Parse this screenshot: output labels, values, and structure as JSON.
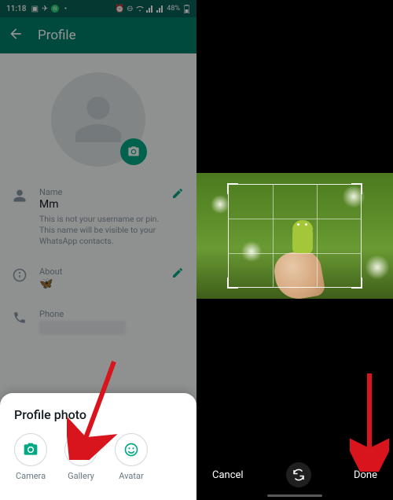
{
  "status": {
    "time": "11:18",
    "battery": "48%"
  },
  "left": {
    "appbar_title": "Profile",
    "fields": {
      "name_label": "Name",
      "name_value": "Mm",
      "name_hint": "This is not your username or pin. This name will be visible to your WhatsApp contacts.",
      "about_label": "About",
      "about_value": "🦋",
      "phone_label": "Phone"
    },
    "sheet": {
      "title": "Profile photo",
      "options": [
        {
          "label": "Camera"
        },
        {
          "label": "Gallery"
        },
        {
          "label": "Avatar"
        }
      ]
    }
  },
  "right": {
    "cancel_label": "Cancel",
    "done_label": "Done"
  },
  "colors": {
    "primary": "#008069",
    "accent": "#00a884"
  }
}
